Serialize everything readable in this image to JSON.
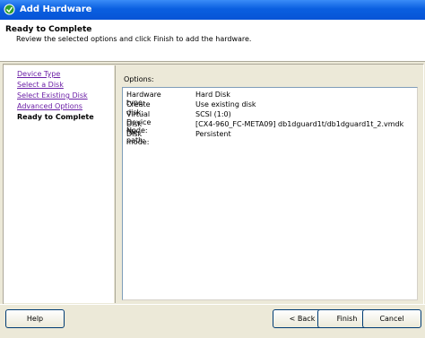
{
  "window": {
    "title": "Add Hardware"
  },
  "header": {
    "heading": "Ready to Complete",
    "description": "Review the selected options and click Finish to add the hardware."
  },
  "nav": {
    "items": [
      {
        "label": "Device Type",
        "state": "link"
      },
      {
        "label": "Select a Disk",
        "state": "link"
      },
      {
        "label": "Select Existing Disk",
        "state": "link"
      },
      {
        "label": "Advanced Options",
        "state": "link"
      },
      {
        "label": "Ready to Complete",
        "state": "current"
      }
    ]
  },
  "options": {
    "label": "Options:",
    "rows": [
      {
        "key": "Hardware type:",
        "value": "Hard Disk"
      },
      {
        "key": "Create disk:",
        "value": "Use existing disk"
      },
      {
        "key": "Virtual Device Node:",
        "value": "SCSI (1:0)"
      },
      {
        "key": "Disk file path:",
        "value": "[CX4-960_FC-META09] db1dguard1t/db1dguard1t_2.vmdk"
      },
      {
        "key": "Disk mode:",
        "value": "Persistent"
      }
    ]
  },
  "buttons": {
    "help": "Help",
    "back": "< Back",
    "finish": "Finish",
    "cancel": "Cancel"
  },
  "colors": {
    "titlebar": "#0a5fe0",
    "link": "#6b1fa6",
    "dialog_bg": "#ece9d8"
  }
}
